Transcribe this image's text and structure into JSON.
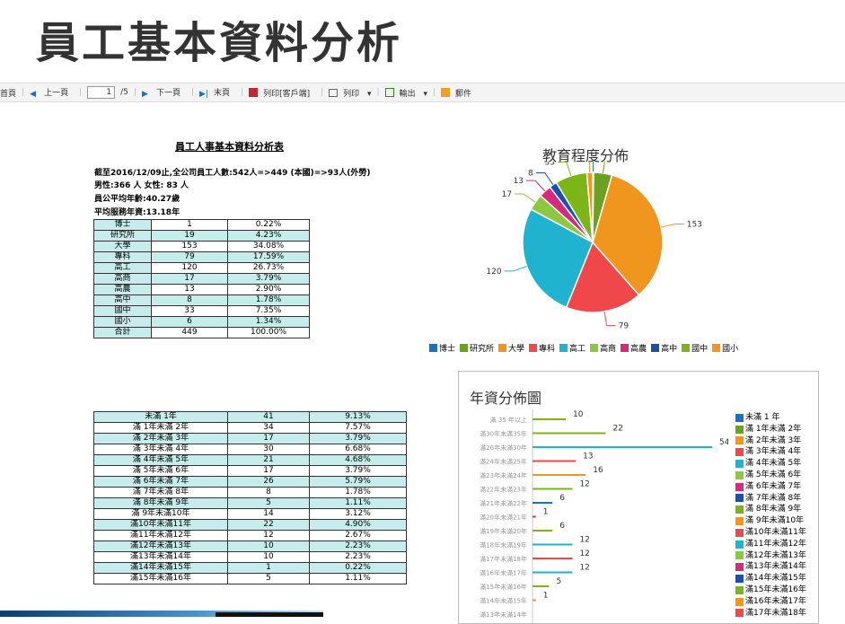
{
  "page_title": "員工基本資料分析",
  "toolbar": {
    "first": "首頁",
    "prev": "上一頁",
    "page": "1",
    "total": "/5",
    "next": "下一頁",
    "last": "末頁",
    "print_client": "列印[客戶端]",
    "print": "列印",
    "export": "輸出",
    "mail": "郵件"
  },
  "report": {
    "title": "員工人事基本資料分析表",
    "line1": "截至2016/12/09止,全公司員工人數:542人=>449 (本國)=>93人(外勞)",
    "line2": "男性:366 人 女性: 83 人",
    "line3": "員公平均年齡:40.27歲",
    "line4": "平均服務年資:13.18年"
  },
  "education_table": [
    [
      "博士",
      "1",
      "0.22%"
    ],
    [
      "研究所",
      "19",
      "4.23%"
    ],
    [
      "大學",
      "153",
      "34.08%"
    ],
    [
      "專科",
      "79",
      "17.59%"
    ],
    [
      "高工",
      "120",
      "26.73%"
    ],
    [
      "高商",
      "17",
      "3.79%"
    ],
    [
      "高農",
      "13",
      "2.90%"
    ],
    [
      "高中",
      "8",
      "1.78%"
    ],
    [
      "國中",
      "33",
      "7.35%"
    ],
    [
      "國小",
      "6",
      "1.34%"
    ],
    [
      "合計",
      "449",
      "100.00%"
    ]
  ],
  "seniority_table": [
    [
      "未滿 1年",
      "41",
      "9.13%"
    ],
    [
      "滿 1年未滿 2年",
      "34",
      "7.57%"
    ],
    [
      "滿 2年未滿 3年",
      "17",
      "3.79%"
    ],
    [
      "滿 3年未滿 4年",
      "30",
      "6.68%"
    ],
    [
      "滿 4年未滿 5年",
      "21",
      "4.68%"
    ],
    [
      "滿 5年未滿 6年",
      "17",
      "3.79%"
    ],
    [
      "滿 6年未滿 7年",
      "26",
      "5.79%"
    ],
    [
      "滿 7年未滿 8年",
      "8",
      "1.78%"
    ],
    [
      "滿 8年未滿 9年",
      "5",
      "1.11%"
    ],
    [
      "滿 9年未滿10年",
      "14",
      "3.12%"
    ],
    [
      "滿10年未滿11年",
      "22",
      "4.90%"
    ],
    [
      "滿11年未滿12年",
      "12",
      "2.67%"
    ],
    [
      "滿12年未滿13年",
      "10",
      "2.23%"
    ],
    [
      "滿13年未滿14年",
      "10",
      "2.23%"
    ],
    [
      "滿14年未滿15年",
      "1",
      "0.22%"
    ],
    [
      "滿15年未滿16年",
      "5",
      "1.11%"
    ]
  ],
  "chart_data": [
    {
      "type": "pie",
      "title": "教育程度分佈",
      "categories": [
        "博士",
        "研究所",
        "大學",
        "專科",
        "高工",
        "高商",
        "高農",
        "高中",
        "國中",
        "國小"
      ],
      "values": [
        1,
        19,
        153,
        79,
        120,
        17,
        13,
        8,
        33,
        6
      ],
      "colors": [
        "#1f6fbf",
        "#6aa121",
        "#f0961e",
        "#f0484a",
        "#1fb3cf",
        "#8dc63f",
        "#d62a7e",
        "#1a4fae",
        "#7cb518",
        "#f7941d"
      ],
      "legend": "bottom"
    },
    {
      "type": "bar",
      "title": "年資分佈圖",
      "categories": [
        "滿 35 年以上",
        "滿30年未滿35年",
        "滿26年未滿30年",
        "滿24年未滿25年",
        "滿23年未滿24年",
        "滿22年未滿23年",
        "滿21年未滿22年",
        "滿20年未滿21年",
        "滿19年未滿20年",
        "滿18年未滿19年",
        "滿17年未滿18年",
        "滿16年未滿17年",
        "滿15年未滿16年",
        "滿14年未滿15年",
        "滿13年未滿14年"
      ],
      "values": [
        10,
        22,
        54,
        13,
        16,
        12,
        6,
        1,
        6,
        12,
        12,
        12,
        5,
        1,
        null
      ],
      "colors": [
        "#7cb518",
        "#7cb518",
        "#1fb3cf",
        "#f0484a",
        "#f0961e",
        "#7cb518",
        "#1f6fbf",
        "#d62a7e",
        "#7cb518",
        "#1fb3cf",
        "#f0484a",
        "#1fb3cf",
        "#7cb518",
        "#f0961e",
        "#6a3fa0"
      ],
      "legend_items": [
        "未滿 1 年",
        "滿 1年未滿 2年",
        "滿 2年未滿 3年",
        "滿 3年未滿 4年",
        "滿 4年未滿 5年",
        "滿 5年未滿 6年",
        "滿 6年未滿 7年",
        "滿 7年未滿 8年",
        "滿 8年未滿 9年",
        "滿 9年未滿10年",
        "滿10年未滿11年",
        "滿11年未滿12年",
        "滿12年未滿13年",
        "滿13年未滿14年",
        "滿14年未滿15年",
        "滿15年未滿16年",
        "滿16年未滿17年",
        "滿17年未滿18年"
      ],
      "legend_colors": [
        "#1f6fbf",
        "#6aa121",
        "#f0961e",
        "#f0484a",
        "#1fb3cf",
        "#8dc63f",
        "#d62a7e",
        "#1a4fae",
        "#7cb518",
        "#f7941d",
        "#f0484a",
        "#1fb3cf",
        "#8dc63f",
        "#d62a7e",
        "#1a4fae",
        "#7cb518",
        "#f7941d",
        "#f0484a"
      ],
      "legend": "right"
    }
  ]
}
